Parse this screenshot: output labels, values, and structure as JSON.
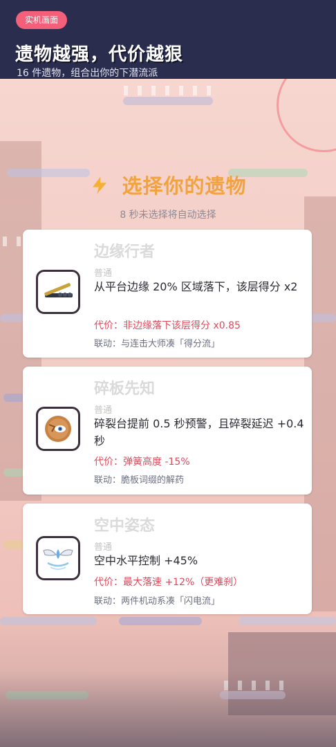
{
  "header": {
    "tag": "实机画面",
    "headline": "遗物越强，代价越狠",
    "subline": "16 件遗物，组合出你的下潜流派"
  },
  "overlay": {
    "title_icon": "lightning-bolt-icon",
    "title": "选择你的遗物",
    "countdown": "8 秒未选择将自动选择"
  },
  "relics": [
    {
      "name": "边缘行者",
      "rarity": "普通",
      "effect": "从平台边缘 20% 区域落下，该层得分 x2",
      "cost": "代价：非边缘落下该层得分 x0.85",
      "synergy": "联动：与连击大师凑「得分流」",
      "icon": "edge-plank-icon"
    },
    {
      "name": "碎板先知",
      "rarity": "普通",
      "effect": "碎裂台提前 0.5 秒预警，且碎裂延迟 +0.4 秒",
      "cost": "代价：弹簧高度 -15%",
      "synergy": "联动：脆板词缀的解药",
      "icon": "cracked-eye-cookie-icon"
    },
    {
      "name": "空中姿态",
      "rarity": "普通",
      "effect": "空中水平控制 +45%",
      "cost": "代价：最大落速 +12%（更难刹）",
      "synergy": "联动：两件机动系凑「闪电流」",
      "icon": "winged-drop-icon"
    }
  ],
  "colors": {
    "header_bg": "#2b2d4f",
    "tag_bg": "#f4607a",
    "title": "#f2a341",
    "cost": "#e0495b",
    "synergy": "#6c6f82"
  }
}
